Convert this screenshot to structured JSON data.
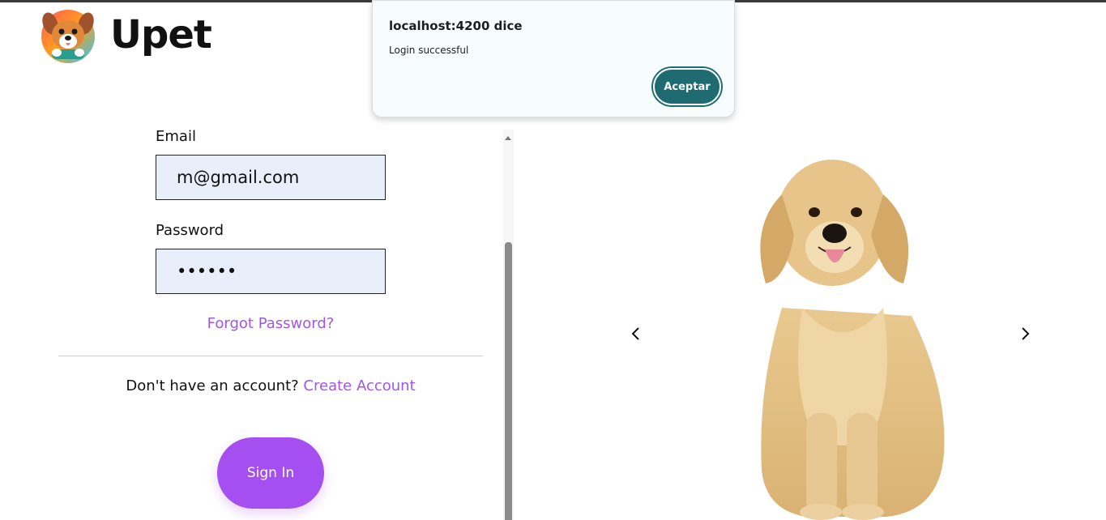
{
  "brand": {
    "name": "Upet",
    "logo_icon": "puppy-logo-icon"
  },
  "form": {
    "email_label": "Email",
    "email_value": "m@gmail.com",
    "password_label": "Password",
    "password_value": "••••••",
    "forgot_password": "Forgot Password?",
    "no_account_text": "Don't have an account?",
    "create_account": "Create Account",
    "sign_in": "Sign In"
  },
  "carousel": {
    "prev_icon": "chevron-left-icon",
    "next_icon": "chevron-right-icon",
    "image_subject": "golden-retriever-dog"
  },
  "dialog": {
    "title": "localhost:4200 dice",
    "message": "Login successful",
    "ok_label": "Aceptar"
  },
  "colors": {
    "accent": "#a64ff0",
    "link": "#a155ea",
    "input_bg": "#e8effb",
    "dialog_button": "#1e6c72"
  }
}
